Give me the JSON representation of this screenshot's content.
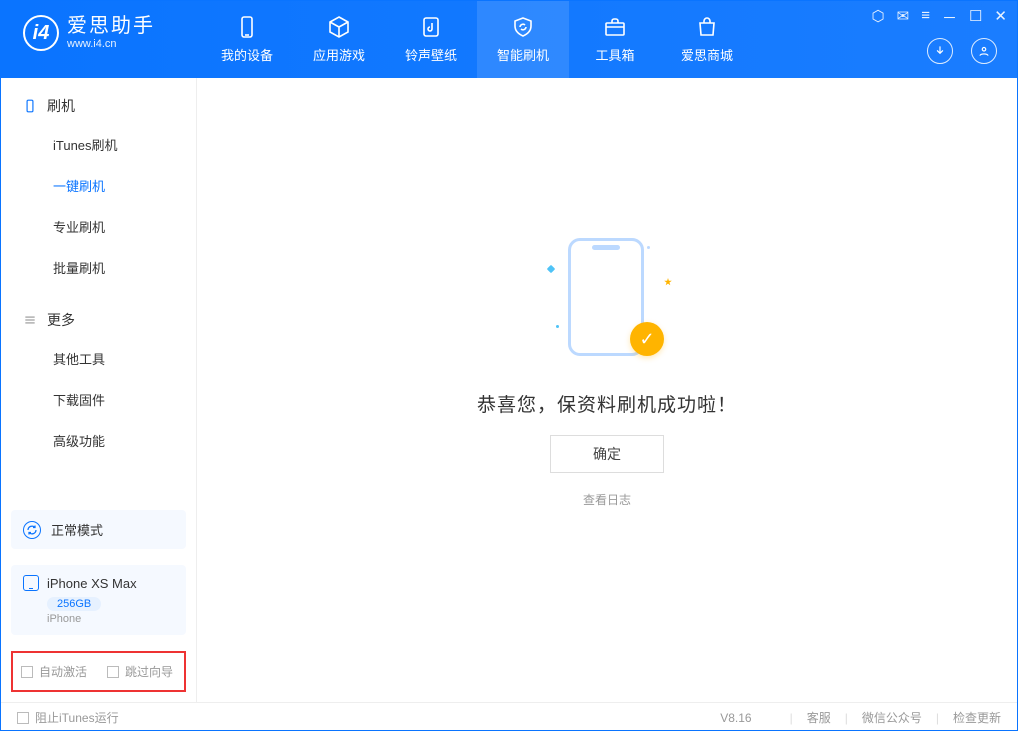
{
  "app": {
    "name_cn": "爱思助手",
    "name_en": "www.i4.cn"
  },
  "tabs": {
    "device": "我的设备",
    "apps": "应用游戏",
    "ring": "铃声壁纸",
    "flash": "智能刷机",
    "toolbox": "工具箱",
    "store": "爱思商城"
  },
  "sidebar": {
    "section_flash": "刷机",
    "items_flash": {
      "itunes": "iTunes刷机",
      "one_click": "一键刷机",
      "pro": "专业刷机",
      "batch": "批量刷机"
    },
    "section_more": "更多",
    "items_more": {
      "other_tools": "其他工具",
      "download_fw": "下载固件",
      "advanced": "高级功能"
    }
  },
  "device": {
    "mode": "正常模式",
    "name": "iPhone XS Max",
    "capacity": "256GB",
    "type": "iPhone"
  },
  "options": {
    "auto_activate": "自动激活",
    "skip_guide": "跳过向导"
  },
  "main": {
    "success": "恭喜您，保资料刷机成功啦！",
    "ok": "确定",
    "view_log": "查看日志"
  },
  "footer": {
    "block_itunes": "阻止iTunes运行",
    "version": "V8.16",
    "support": "客服",
    "wechat": "微信公众号",
    "update": "检查更新"
  }
}
